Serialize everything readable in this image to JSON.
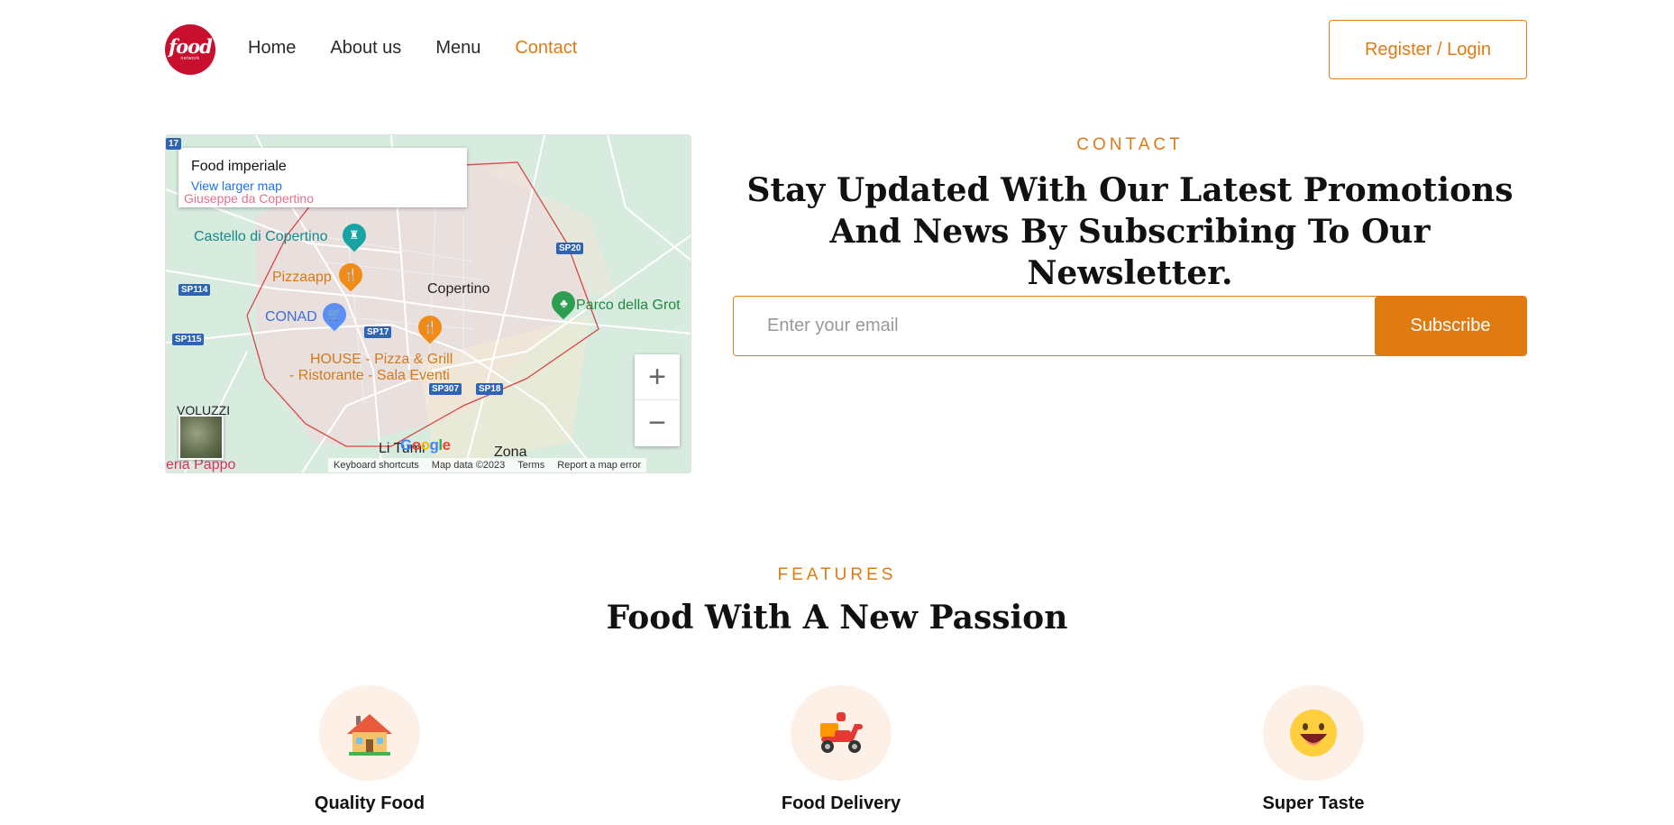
{
  "brand": {
    "logo_word": "food",
    "logo_sub": "network"
  },
  "nav": {
    "items": [
      {
        "label": "Home",
        "active": false
      },
      {
        "label": "About us",
        "active": false
      },
      {
        "label": "Menu",
        "active": false
      },
      {
        "label": "Contact",
        "active": true
      }
    ],
    "login_label": "Register / Login"
  },
  "map": {
    "place_name": "Food imperiale",
    "larger_map_link": "View larger map",
    "labels": {
      "castello": "Castello di Copertino",
      "pizzaapp": "Pizzaapp",
      "copertino": "Copertino",
      "parco": "Parco della Grot",
      "conad": "CONAD",
      "house_line1": "HOUSE - Pizza & Grill",
      "house_line2": "- Ristorante - Sala Eventi",
      "voluzzi": "VOLUZZI",
      "litumi": "Li Tumi",
      "zona": "Zona",
      "pappo": "eria Pappo",
      "top_cut": "Giuseppe da Copertino"
    },
    "roads": [
      "SP20",
      "SP114",
      "SP115",
      "SP17",
      "SP307",
      "SP18",
      "17"
    ],
    "zoom_in": "+",
    "zoom_out": "−",
    "google": "Google",
    "attribution": {
      "shortcuts": "Keyboard shortcuts",
      "data": "Map data ©2023",
      "terms": "Terms",
      "report": "Report a map error"
    }
  },
  "contact": {
    "eyebrow": "CONTACT",
    "heading": "Stay Updated With Our Latest Promotions And News By Subscribing To Our Newsletter.",
    "email_placeholder": "Enter your email",
    "subscribe_label": "Subscribe"
  },
  "features": {
    "eyebrow": "FEATURES",
    "heading": "Food With A New Passion",
    "items": [
      {
        "title": "Quality Food",
        "icon": "house-icon"
      },
      {
        "title": "Food Delivery",
        "icon": "scooter-icon"
      },
      {
        "title": "Super Taste",
        "icon": "smile-icon"
      }
    ]
  },
  "colors": {
    "accent": "#e07b12",
    "logo_red": "#c8102e",
    "feature_bg": "#fdf0e6"
  }
}
